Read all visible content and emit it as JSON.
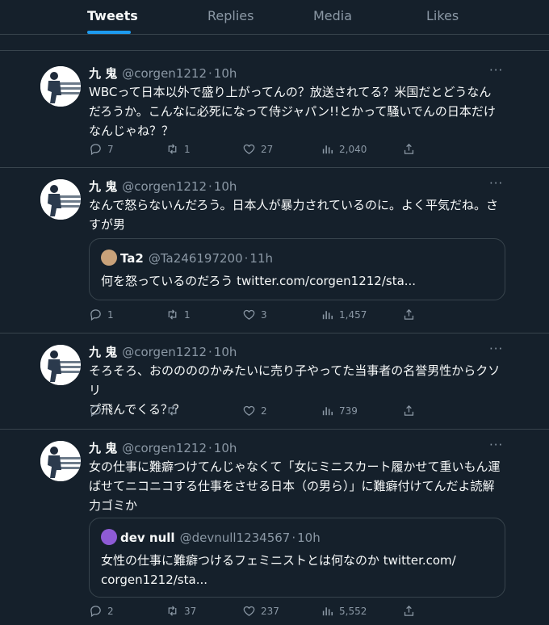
{
  "tabs": [
    "Tweets",
    "Replies",
    "Media",
    "Likes"
  ],
  "tweets": [
    {
      "name": "九 鬼",
      "handle": "@corgen1212",
      "time": "10h",
      "lines": [
        "WBCって日本以外で盛り上がってんの？放送されてる？米国だとどうなん",
        "だろうか。こんなに必死になって侍ジャパン!!とかって騒いでんの日本だけ",
        "なんじゃね？？"
      ],
      "reply": "7",
      "retweet": "1",
      "like": "27",
      "views": "2,040"
    },
    {
      "name": "九 鬼",
      "handle": "@corgen1212",
      "time": "10h",
      "lines": [
        "なんで怒らないんだろう。日本人が暴力されているのに。よく平気だね。さ",
        "すが男"
      ],
      "quote": {
        "name": "Ta2",
        "handle": "@Ta246197200",
        "time": "11h",
        "lines": [
          "何を怒っているのだろう twitter.com/corgen1212/sta..."
        ]
      },
      "reply": "1",
      "retweet": "1",
      "like": "3",
      "views": "1,457"
    },
    {
      "name": "九 鬼",
      "handle": "@corgen1212",
      "time": "10h",
      "lines": [
        "そろそろ、おののののかみたいに売り子やってた当事者の名誉男性からクソリ",
        "プ飛んでくる？？"
      ],
      "reply": "",
      "retweet": "",
      "like": "2",
      "views": "739"
    },
    {
      "name": "九 鬼",
      "handle": "@corgen1212",
      "time": "10h",
      "lines": [
        "女の仕事に難癖つけてんじゃなくて「女にミニスカート履かせて重いもん運",
        "ばせてニコニコする仕事をさせる日本（の男ら）」に難癖付けてんだよ読解",
        "力ゴミか"
      ],
      "quote": {
        "name": "dev null",
        "handle": "@devnull1234567",
        "time": "10h",
        "lines": [
          "女性の仕事に難癖つけるフェミニストとは何なのか twitter.com/",
          "corgen1212/sta..."
        ]
      },
      "reply": "2",
      "retweet": "37",
      "like": "237",
      "views": "5,552"
    }
  ],
  "more_symbol": "···",
  "sep": "·",
  "colors": {
    "accent": "#1d9bf0",
    "background": "#15202b",
    "muted": "#8b98a5"
  }
}
